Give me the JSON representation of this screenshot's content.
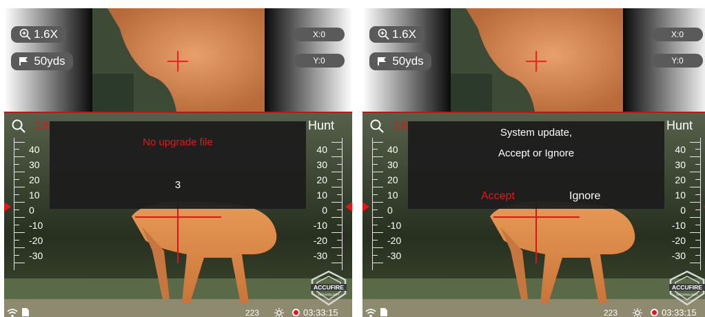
{
  "colors": {
    "accent": "#e01818",
    "chip_bg": "#5a5a5a",
    "dialog_bg": "#1c1c1c"
  },
  "panels": [
    {
      "pip": {
        "zoom": "1.6X",
        "range": "50yds",
        "x": "X:0",
        "y": "Y:0"
      },
      "view": {
        "magnification": "1X",
        "mode": "Hunt",
        "scale_left": [
          "40",
          "30",
          "20",
          "10",
          "0",
          "-10",
          "-20",
          "-30"
        ],
        "scale_right": [
          "40",
          "30",
          "20",
          "10",
          "0",
          "-10",
          "-20",
          "-30"
        ],
        "logo_text": "ACCUFIRE",
        "logo_subtext": "TECHNOLOGY"
      },
      "dialog": {
        "message": "No upgrade file",
        "countdown": "3"
      },
      "status": {
        "ballistic": "223",
        "time": "03:33:15"
      }
    },
    {
      "pip": {
        "zoom": "1.6X",
        "range": "50yds",
        "x": "X:0",
        "y": "Y:0"
      },
      "view": {
        "magnification": "1X",
        "mode": "Hunt",
        "scale_left": [
          "40",
          "30",
          "20",
          "10",
          "0",
          "-10",
          "-20",
          "-30"
        ],
        "scale_right": [
          "40",
          "30",
          "20",
          "10",
          "0",
          "-10",
          "-20",
          "-30"
        ],
        "logo_text": "ACCUFIRE",
        "logo_subtext": "TECHNOLOGY"
      },
      "dialog": {
        "line1": "System update,",
        "line2": "Accept or Ignore",
        "accept_label": "Accept",
        "ignore_label": "Ignore"
      },
      "status": {
        "ballistic": "223",
        "time": "03:33:15"
      }
    }
  ],
  "icons": [
    "zoom-magnifier-icon",
    "flag-icon",
    "search-icon",
    "wifi-icon",
    "sd-card-icon",
    "brightness-icon",
    "record-icon",
    "accufire-logo"
  ]
}
